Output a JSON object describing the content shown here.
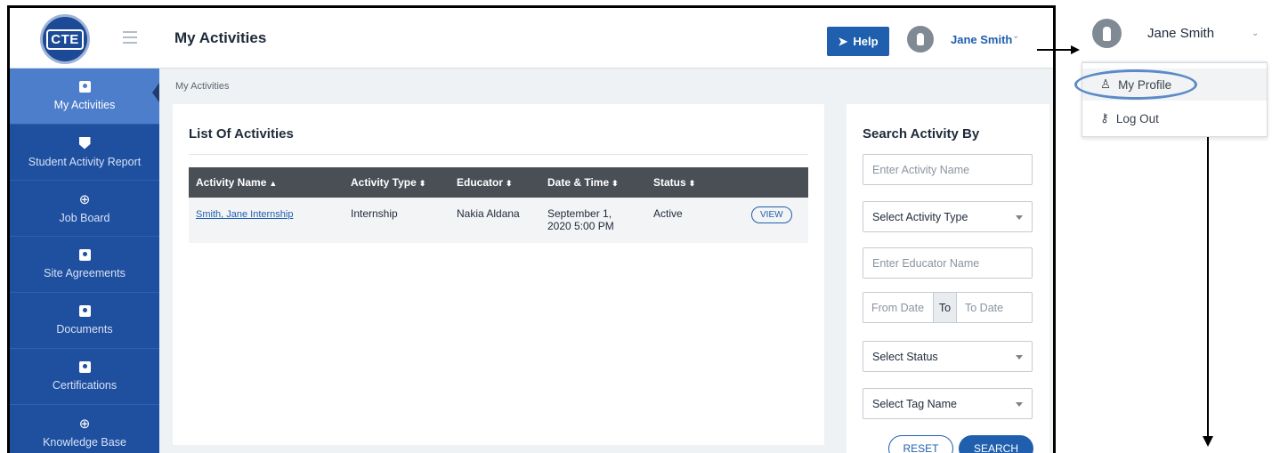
{
  "app": {
    "logo_text": "CTE"
  },
  "sidebar": {
    "items": [
      {
        "label": "My Activities",
        "icon": "calendar-icon",
        "active": true
      },
      {
        "label": "Student Activity Report",
        "icon": "shield-check-icon",
        "active": false
      },
      {
        "label": "Job Board",
        "icon": "globe-icon",
        "active": false
      },
      {
        "label": "Site Agreements",
        "icon": "calendar-icon",
        "active": false
      },
      {
        "label": "Documents",
        "icon": "calendar-icon",
        "active": false
      },
      {
        "label": "Certifications",
        "icon": "calendar-icon",
        "active": false
      },
      {
        "label": "Knowledge Base",
        "icon": "globe-icon",
        "active": false
      }
    ]
  },
  "header": {
    "title": "My Activities",
    "help_label": "Help",
    "user_name": "Jane Smith"
  },
  "breadcrumb": "My Activities",
  "activities": {
    "title": "List Of Activities",
    "columns": [
      "Activity Name",
      "Activity Type",
      "Educator",
      "Date & Time",
      "Status"
    ],
    "rows": [
      {
        "name": "Smith, Jane Internship",
        "type": "Internship",
        "educator": "Nakia Aldana",
        "date_line1": "September 1,",
        "date_line2": "2020 5:00 PM",
        "status": "Active",
        "action": "VIEW"
      }
    ]
  },
  "search": {
    "title": "Search Activity By",
    "activity_name_placeholder": "Enter Activity Name",
    "activity_type_selected": "Select Activity Type",
    "educator_placeholder": "Enter Educator Name",
    "from_date_placeholder": "From Date",
    "to_label": "To",
    "to_date_placeholder": "To Date",
    "status_selected": "Select Status",
    "tag_selected": "Select Tag Name",
    "reset_label": "RESET",
    "search_label": "SEARCH"
  },
  "user_menu": {
    "user_name": "Jane Smith",
    "items": [
      {
        "label": "My Profile",
        "icon": "user-icon"
      },
      {
        "label": "Log Out",
        "icon": "key-icon"
      }
    ]
  },
  "colors": {
    "sidebar": "#1f4f9f",
    "sidebar_active": "#4d7ecb",
    "accent": "#1f5fae",
    "table_header": "#4a4f56"
  }
}
